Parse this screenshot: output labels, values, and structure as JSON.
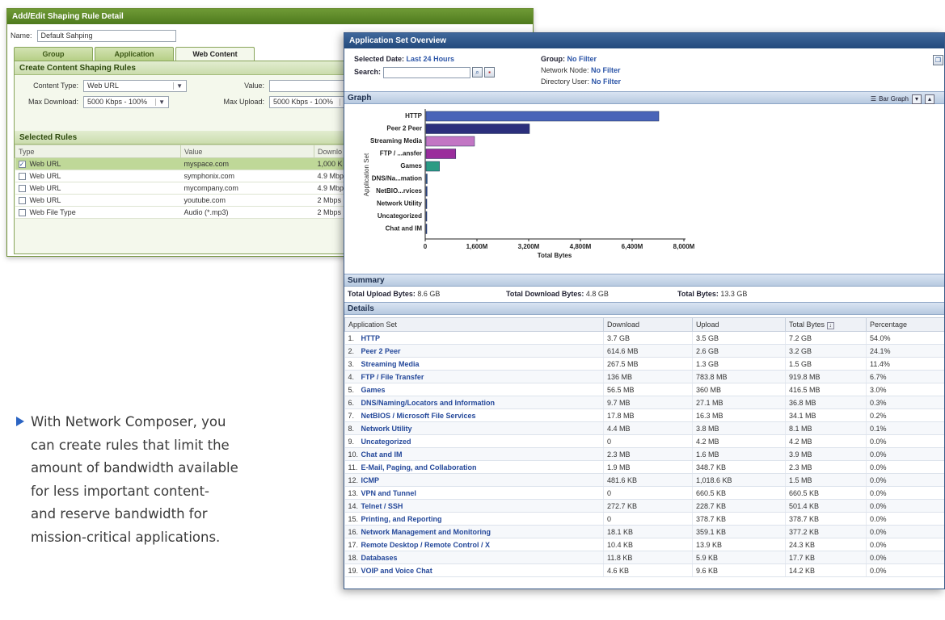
{
  "rule_window": {
    "title": "Add/Edit Shaping Rule Detail",
    "name_label": "Name:",
    "name_value": "Default Sahping",
    "tabs": [
      {
        "label": "Group",
        "active": false
      },
      {
        "label": "Application",
        "active": false
      },
      {
        "label": "Web Content",
        "active": true
      }
    ],
    "create_section": {
      "title": "Create Content Shaping Rules",
      "content_type_label": "Content Type:",
      "content_type_value": "Web URL",
      "value_label": "Value:",
      "value_value": "",
      "max_download_label": "Max Download:",
      "max_download_value": "5000 Kbps - 100%",
      "max_upload_label": "Max Upload:",
      "max_upload_value": "5000 Kbps - 100%"
    },
    "selected_rules": {
      "title": "Selected Rules",
      "columns": [
        "Type",
        "Value",
        "Downlo"
      ],
      "rows": [
        {
          "type": "Web URL",
          "value": "myspace.com",
          "download": "1,000 K",
          "checked": true,
          "selected": true
        },
        {
          "type": "Web URL",
          "value": "symphonix.com",
          "download": "4.9 Mbp",
          "checked": false,
          "selected": false
        },
        {
          "type": "Web URL",
          "value": "mycompany.com",
          "download": "4.9 Mbp",
          "checked": false,
          "selected": false
        },
        {
          "type": "Web URL",
          "value": "youtube.com",
          "download": "2 Mbps",
          "checked": false,
          "selected": false
        },
        {
          "type": "Web File Type",
          "value": "Audio (*.mp3)",
          "download": "2 Mbps",
          "checked": false,
          "selected": false
        }
      ]
    }
  },
  "app_window": {
    "title": "Application Set Overview",
    "selected_date_label": "Selected Date:",
    "selected_date_value": "Last 24 Hours",
    "search_label": "Search:",
    "search_value": "",
    "group_label": "Group:",
    "group_value": "No Filter",
    "network_node_label": "Network Node:",
    "network_node_value": "No Filter",
    "directory_user_label": "Directory User:",
    "directory_user_value": "No Filter",
    "graph_section": "Graph",
    "graph_type_label": "Bar Graph",
    "summary_section": "Summary",
    "total_upload_label": "Total Upload Bytes:",
    "total_upload_value": "8.6 GB",
    "total_download_label": "Total Download Bytes:",
    "total_download_value": "4.8 GB",
    "total_bytes_label": "Total Bytes:",
    "total_bytes_value": "13.3 GB",
    "details_section": "Details",
    "details_columns": [
      "Application Set",
      "Download",
      "Upload",
      "Total Bytes",
      "Percentage"
    ],
    "details_rows": [
      {
        "idx": "1.",
        "name": "HTTP",
        "download": "3.7 GB",
        "upload": "3.5 GB",
        "total": "7.2 GB",
        "pct": "54.0%"
      },
      {
        "idx": "2.",
        "name": "Peer 2 Peer",
        "download": "614.6 MB",
        "upload": "2.6 GB",
        "total": "3.2 GB",
        "pct": "24.1%"
      },
      {
        "idx": "3.",
        "name": "Streaming Media",
        "download": "267.5 MB",
        "upload": "1.3 GB",
        "total": "1.5 GB",
        "pct": "11.4%"
      },
      {
        "idx": "4.",
        "name": "FTP / File Transfer",
        "download": "136 MB",
        "upload": "783.8 MB",
        "total": "919.8 MB",
        "pct": "6.7%"
      },
      {
        "idx": "5.",
        "name": "Games",
        "download": "56.5 MB",
        "upload": "360 MB",
        "total": "416.5 MB",
        "pct": "3.0%"
      },
      {
        "idx": "6.",
        "name": "DNS/Naming/Locators and Information",
        "download": "9.7 MB",
        "upload": "27.1 MB",
        "total": "36.8 MB",
        "pct": "0.3%"
      },
      {
        "idx": "7.",
        "name": "NetBIOS / Microsoft File Services",
        "download": "17.8 MB",
        "upload": "16.3 MB",
        "total": "34.1 MB",
        "pct": "0.2%"
      },
      {
        "idx": "8.",
        "name": "Network Utility",
        "download": "4.4 MB",
        "upload": "3.8 MB",
        "total": "8.1 MB",
        "pct": "0.1%"
      },
      {
        "idx": "9.",
        "name": "Uncategorized",
        "download": "0",
        "upload": "4.2 MB",
        "total": "4.2 MB",
        "pct": "0.0%"
      },
      {
        "idx": "10.",
        "name": "Chat and IM",
        "download": "2.3 MB",
        "upload": "1.6 MB",
        "total": "3.9 MB",
        "pct": "0.0%"
      },
      {
        "idx": "11.",
        "name": "E-Mail, Paging, and Collaboration",
        "download": "1.9 MB",
        "upload": "348.7 KB",
        "total": "2.3 MB",
        "pct": "0.0%"
      },
      {
        "idx": "12.",
        "name": "ICMP",
        "download": "481.6 KB",
        "upload": "1,018.6 KB",
        "total": "1.5 MB",
        "pct": "0.0%"
      },
      {
        "idx": "13.",
        "name": "VPN and Tunnel",
        "download": "0",
        "upload": "660.5 KB",
        "total": "660.5 KB",
        "pct": "0.0%"
      },
      {
        "idx": "14.",
        "name": "Telnet / SSH",
        "download": "272.7 KB",
        "upload": "228.7 KB",
        "total": "501.4 KB",
        "pct": "0.0%"
      },
      {
        "idx": "15.",
        "name": "Printing, and Reporting",
        "download": "0",
        "upload": "378.7 KB",
        "total": "378.7 KB",
        "pct": "0.0%"
      },
      {
        "idx": "16.",
        "name": "Network Management and Monitoring",
        "download": "18.1 KB",
        "upload": "359.1 KB",
        "total": "377.2 KB",
        "pct": "0.0%"
      },
      {
        "idx": "17.",
        "name": "Remote Desktop / Remote Control / X",
        "download": "10.4 KB",
        "upload": "13.9 KB",
        "total": "24.3 KB",
        "pct": "0.0%"
      },
      {
        "idx": "18.",
        "name": "Databases",
        "download": "11.8 KB",
        "upload": "5.9 KB",
        "total": "17.7 KB",
        "pct": "0.0%"
      },
      {
        "idx": "19.",
        "name": "VOIP and Voice Chat",
        "download": "4.6 KB",
        "upload": "9.6 KB",
        "total": "14.2 KB",
        "pct": "0.0%"
      }
    ]
  },
  "chart_data": {
    "type": "bar",
    "orientation": "horizontal",
    "title": "",
    "xlabel": "Total Bytes",
    "ylabel": "Application Set",
    "xlim": [
      0,
      8000000000
    ],
    "x_tick_labels": [
      "0",
      "1,600M",
      "3,200M",
      "4,800M",
      "6,400M",
      "8,000M"
    ],
    "x_tick_values": [
      0,
      1600000000,
      3200000000,
      4800000000,
      6400000000,
      8000000000
    ],
    "categories": [
      "HTTP",
      "Peer 2 Peer",
      "Streaming Media",
      "FTP / ...ansfer",
      "Games",
      "DNS/Na...mation",
      "NetBIO...rvices",
      "Network Utility",
      "Uncategorized",
      "Chat and IM"
    ],
    "values": [
      7200000000,
      3200000000,
      1500000000,
      919800000,
      416500000,
      36800000,
      34100000,
      8100000,
      4200000,
      3900000
    ],
    "colors": [
      "#4a64b8",
      "#2b2f7c",
      "#c276c4",
      "#9a2d9c",
      "#2a9b84",
      "#2a5c8e",
      "#2a4a8e",
      "#2a4a8e",
      "#2a4a8e",
      "#2a4a8e"
    ],
    "grid": false
  },
  "caption": {
    "text": "With Network Composer, you can create rules that limit the amount of bandwidth available for less important content-and reserve bandwidth for mission-critical applications.",
    "lines": [
      "With Network Composer, you",
      "can create rules that limit the",
      "amount of bandwidth available",
      "for less important content-",
      "and reserve bandwidth for",
      "mission-critical applications."
    ],
    "accent_color": "#2b64c3"
  }
}
